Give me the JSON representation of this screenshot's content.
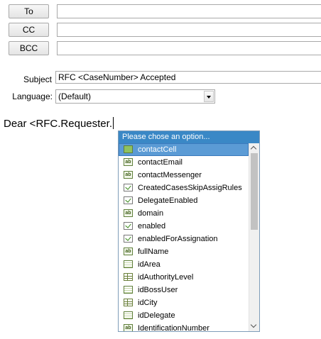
{
  "recipients": {
    "to_label": "To",
    "cc_label": "CC",
    "bcc_label": "BCC",
    "to_value": "",
    "cc_value": "",
    "bcc_value": ""
  },
  "subject": {
    "label": "Subject",
    "value": "RFC <CaseNumber> Accepted"
  },
  "language": {
    "label": "Language:",
    "value": "(Default)"
  },
  "body": {
    "text": "Dear <RFC.Requester."
  },
  "autocomplete": {
    "header": "Please chose an option...",
    "items": [
      {
        "label": "contactCell",
        "icon": "green-field-icon",
        "selected": true
      },
      {
        "label": "contactEmail",
        "icon": "text-field-icon"
      },
      {
        "label": "contactMessenger",
        "icon": "text-field-icon"
      },
      {
        "label": "CreatedCasesSkipAssigRules",
        "icon": "checkbox-icon"
      },
      {
        "label": "DelegateEnabled",
        "icon": "checkbox-icon"
      },
      {
        "label": "domain",
        "icon": "text-field-icon"
      },
      {
        "label": "enabled",
        "icon": "checkbox-icon"
      },
      {
        "label": "enabledForAssignation",
        "icon": "checkbox-icon"
      },
      {
        "label": "fullName",
        "icon": "text-field-icon"
      },
      {
        "label": "idArea",
        "icon": "number-field-icon"
      },
      {
        "label": "idAuthorityLevel",
        "icon": "table-icon"
      },
      {
        "label": "idBossUser",
        "icon": "number-field-icon"
      },
      {
        "label": "idCity",
        "icon": "table-icon"
      },
      {
        "label": "idDelegate",
        "icon": "number-field-icon"
      },
      {
        "label": "IdentificationNumber",
        "icon": "text-field-icon"
      }
    ],
    "icon_text": "ab"
  }
}
